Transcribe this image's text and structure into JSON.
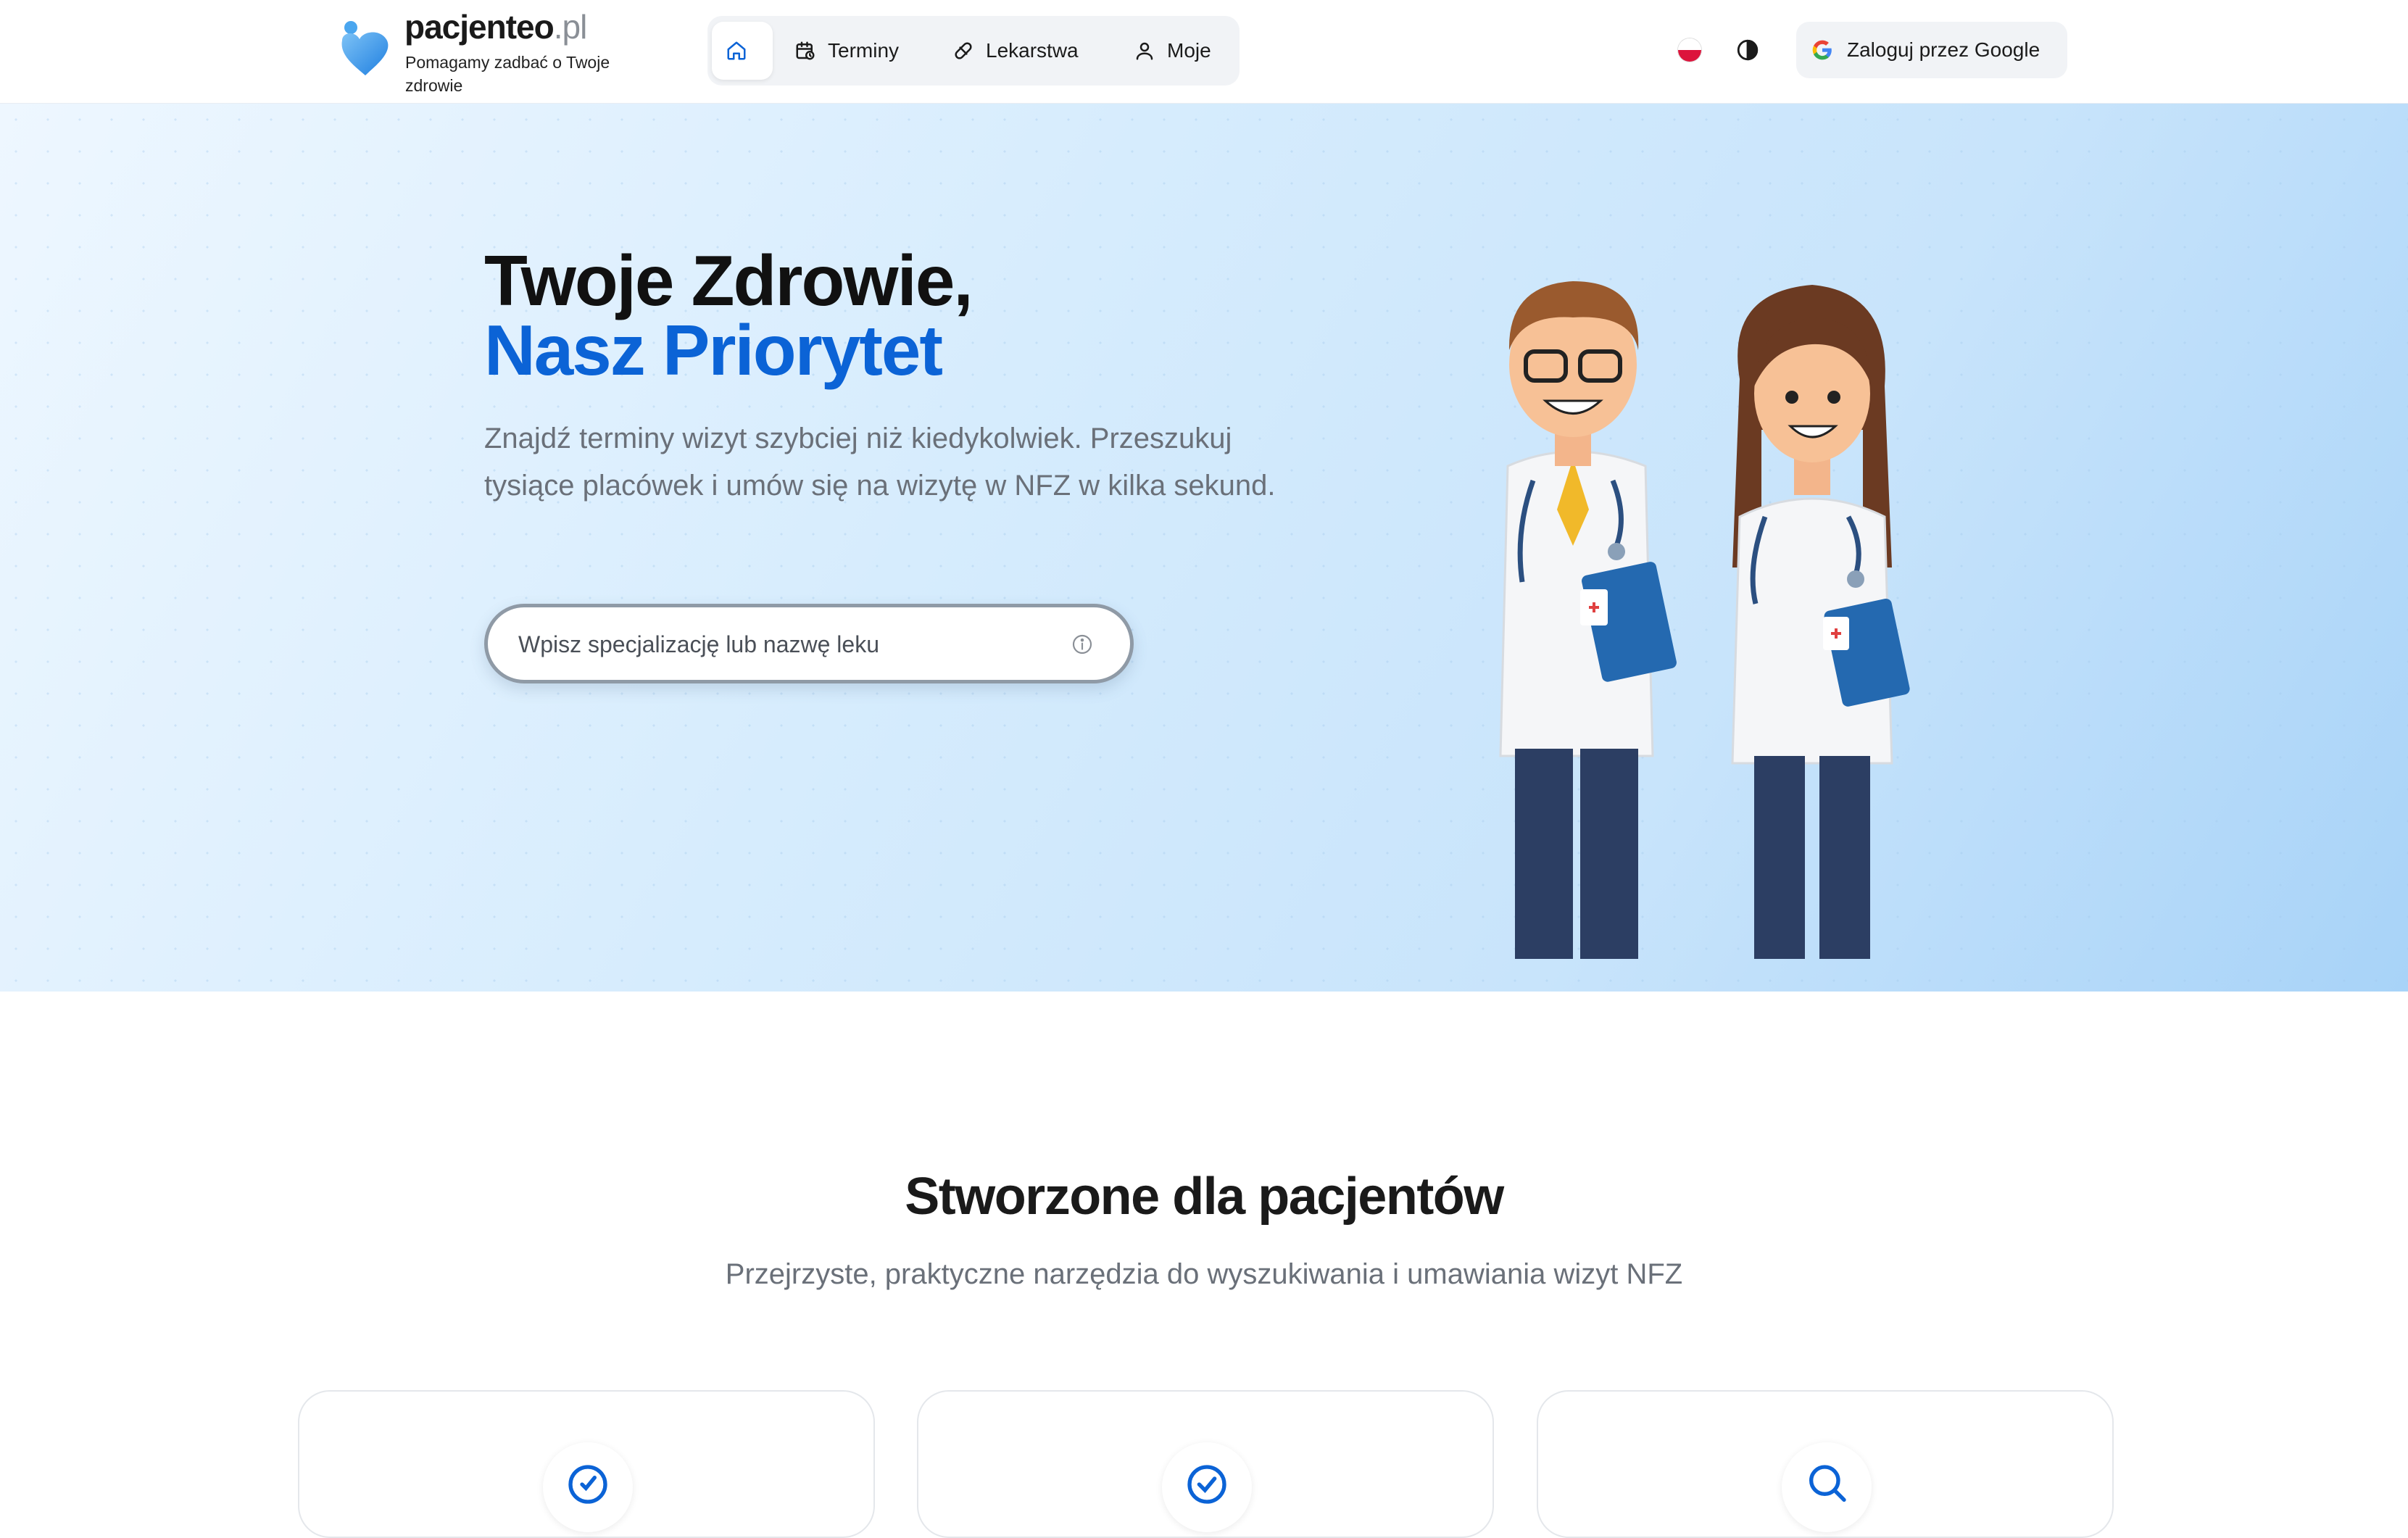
{
  "header": {
    "brand_name": "pacjenteo",
    "brand_tld": ".pl",
    "tagline": "Pomagamy zadbać o Twoje zdrowie",
    "nav": [
      {
        "label": "",
        "icon": "home-icon",
        "active": true
      },
      {
        "label": "Terminy",
        "icon": "calendar-clock-icon"
      },
      {
        "label": "Lekarstwa",
        "icon": "pill-icon"
      },
      {
        "label": "Moje",
        "icon": "user-icon"
      }
    ],
    "language_flag": "flag-pl-icon",
    "theme_toggle_icon": "theme-toggle-icon",
    "login_label": "Zaloguj przez Google"
  },
  "hero": {
    "title_line1": "Twoje Zdrowie,",
    "title_line2": "Nasz Priorytet",
    "description": "Znajdź terminy wizyt szybciej niż kiedykolwiek. Przeszukuj tysiące placówek i umów się na wizytę w NFZ w kilka sekund.",
    "search_placeholder": "Wpisz specjalizację lub nazwę leku",
    "search_value": "",
    "accent_color": "#0b63d6"
  },
  "features": {
    "title": "Stworzone dla pacjentów",
    "subtitle": "Przejrzyste, praktyczne narzędzia do wyszukiwania i umawiania wizyt NFZ",
    "cards": [
      {
        "icon": "check-circle-icon"
      },
      {
        "icon": "check-circle-icon"
      },
      {
        "icon": "search-icon"
      }
    ]
  }
}
